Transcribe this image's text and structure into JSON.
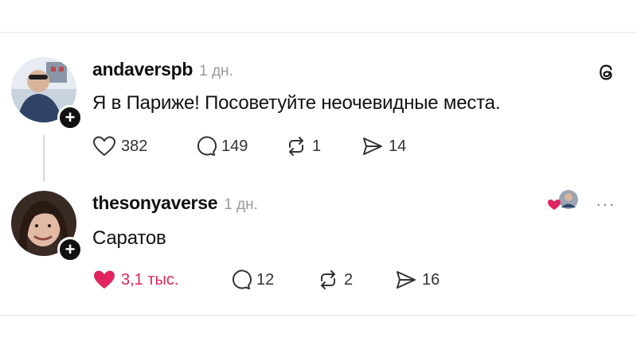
{
  "posts": [
    {
      "username": "andaverspb",
      "time": "1 дн.",
      "text": "Я в Париже! Посоветуйте неочевидные места.",
      "likes": "382",
      "replies": "149",
      "reposts": "1",
      "shares": "14"
    },
    {
      "username": "thesonyaverse",
      "time": "1 дн.",
      "text": "Саратов",
      "likes": "3,1 тыс.",
      "replies": "12",
      "reposts": "2",
      "shares": "16",
      "liked": true
    }
  ],
  "follow_symbol": "+",
  "more_symbol": "···",
  "colors": {
    "like": "#e0245e",
    "text": "#111111",
    "muted": "#9a9a9a"
  },
  "icons": [
    "heart-icon",
    "comment-icon",
    "repost-icon",
    "share-icon",
    "threads-logo-icon",
    "more-icon"
  ]
}
